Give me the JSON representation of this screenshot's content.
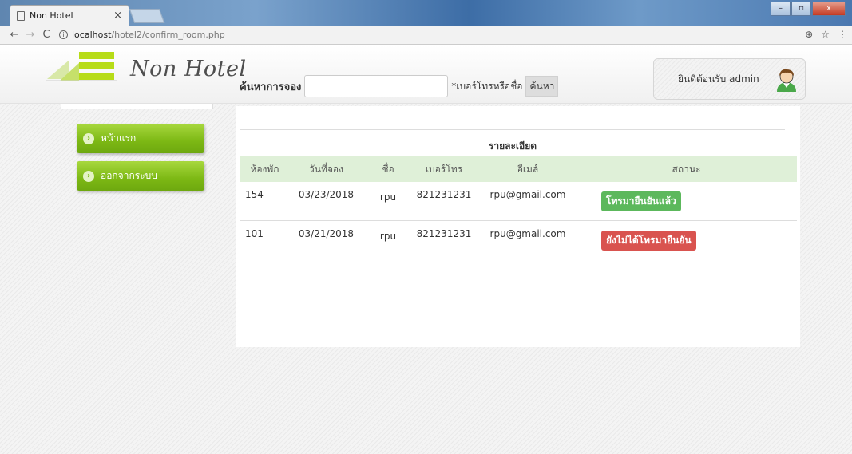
{
  "browser": {
    "tab_title": "Non Hotel",
    "tab_close": "×",
    "url_host": "localhost",
    "url_path": "/hotel2/confirm_room.php",
    "back_icon": "←",
    "forward_icon": "→",
    "reload_icon": "C",
    "info_icon": "i",
    "zoom_icon": "⊕",
    "star_icon": "☆",
    "menu_icon": "⋮",
    "win_min": "–",
    "win_max": "▫",
    "win_close": "x"
  },
  "header": {
    "logo_text": "Non Hotel",
    "welcome": "ยินดีต้อนรับ admin"
  },
  "sidebar": {
    "items": [
      {
        "label": "หน้าแรก",
        "icon": "›"
      },
      {
        "label": "ออกจากระบบ",
        "icon": "›"
      }
    ]
  },
  "search": {
    "label": "ค้นหาการจอง",
    "value": "",
    "hint": "*เบอร์โทรหรือชื่อ",
    "button": "ค้นหา"
  },
  "table": {
    "caption": "รายละเอียด",
    "headers": [
      "ห้องพัก",
      "วันที่จอง",
      "ชื่อ",
      "เบอร์โทร",
      "อีเมล์",
      "สถานะ"
    ],
    "rows": [
      {
        "room": "154",
        "date": "03/23/2018",
        "name": "rpu",
        "phone": "821231231",
        "email": "rpu@gmail.com",
        "status": "โทรมายืนยันแล้ว",
        "status_color": "#5cb85c"
      },
      {
        "room": "101",
        "date": "03/21/2018",
        "name": "rpu",
        "phone": "821231231",
        "email": "rpu@gmail.com",
        "status": "ยังไม่ได้โทรมายืนยัน",
        "status_color": "#d9534f"
      }
    ]
  },
  "colors": {
    "accent_green": "#7cb814",
    "header_row": "#dff0d8",
    "confirmed": "#5cb85c",
    "unconfirmed": "#d9534f"
  }
}
